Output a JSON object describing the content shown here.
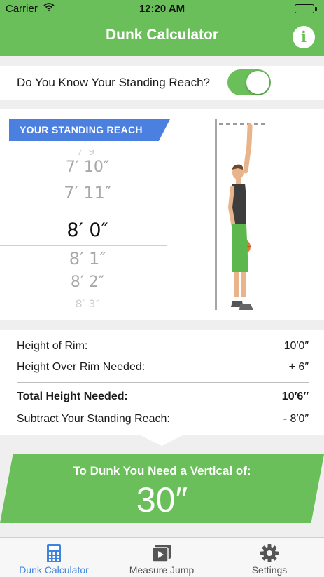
{
  "status_bar": {
    "carrier": "Carrier",
    "time": "12:20 AM"
  },
  "header": {
    "title": "Dunk Calculator",
    "info_icon": "info-icon"
  },
  "standing_reach_toggle": {
    "label": "Do You Know Your Standing Reach?",
    "on": true
  },
  "reach_picker": {
    "banner": "YOUR STANDING REACH",
    "options": [
      "7′ 9″",
      "7′ 10″",
      "7′ 11″",
      "8′ 0″",
      "8′ 1″",
      "8′ 2″",
      "8′ 3″"
    ],
    "selected": "8′ 0″"
  },
  "calculation": {
    "rows": [
      {
        "label": "Height of Rim:",
        "value": "10′0″"
      },
      {
        "label": "Height Over Rim Needed:",
        "value": "+ 6″"
      },
      {
        "label": "Total Height Needed:",
        "value": "10′6″"
      },
      {
        "label": "Subtract Your Standing Reach:",
        "value": "- 8′0″"
      }
    ]
  },
  "result": {
    "label": "To Dunk You Need a Vertical of:",
    "value": "30″"
  },
  "tab_bar": {
    "tabs": [
      {
        "label": "Dunk Calculator",
        "icon": "calculator-icon",
        "active": true
      },
      {
        "label": "Measure Jump",
        "icon": "play-video-icon",
        "active": false
      },
      {
        "label": "Settings",
        "icon": "gear-icon",
        "active": false
      }
    ]
  },
  "colors": {
    "brand_green": "#6abf5a",
    "banner_blue": "#4b7fe0",
    "tab_active": "#3f83e0"
  }
}
